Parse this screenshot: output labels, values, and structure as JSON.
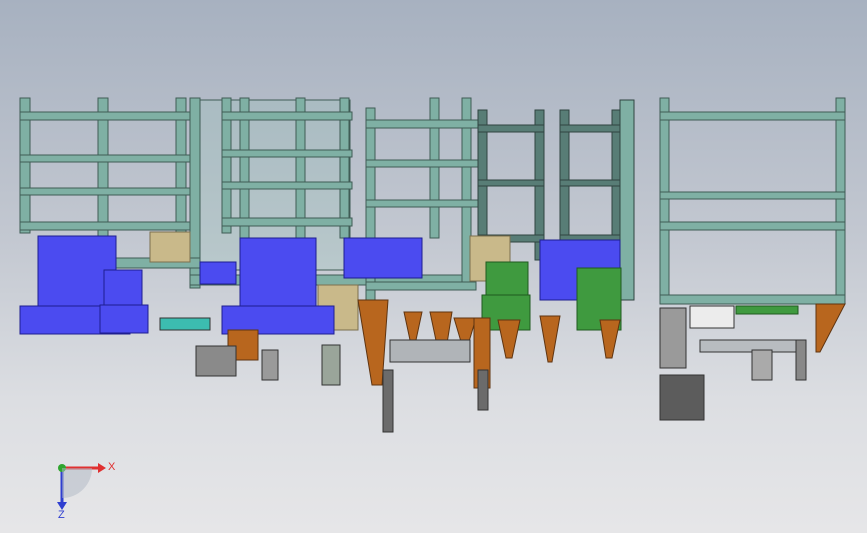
{
  "viewport": {
    "background_top": "#a7b1c0",
    "background_bottom": "#e6e6e8"
  },
  "model": {
    "frame_color": "#7fb0a4",
    "frame_dark": "#4f6f68",
    "tank_blue": "#4b4bf0",
    "tank_green": "#3f9a3f",
    "bracket_orange": "#b8661e",
    "panel_tan": "#c9b98a"
  },
  "triad": {
    "x_label": "X",
    "z_label": "Z",
    "x_color": "#e03030",
    "y_color": "#2fa52f",
    "z_color": "#2f3fd0",
    "icon": "coordinate-triad-icon"
  }
}
